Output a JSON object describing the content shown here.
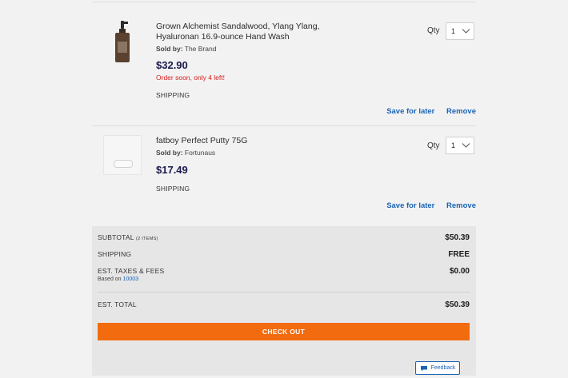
{
  "items": [
    {
      "title_line1": "Grown Alchemist Sandalwood, Ylang Ylang,",
      "title_line2": "Hyaluronan 16.9-ounce Hand Wash",
      "sold_by_label": "Sold by:",
      "seller": "The Brand",
      "price": "$32.90",
      "stock_warning": "Order soon, only 4 left!",
      "shipping": "SHIPPING",
      "qty_label": "Qty",
      "qty_value": "1",
      "save_for_later": "Save for later",
      "remove": "Remove",
      "image_icon": "hand-wash-bottle-icon"
    },
    {
      "title_line1": "fatboy Perfect Putty 75G",
      "sold_by_label": "Sold by:",
      "seller": "Fortunaus",
      "price": "$17.49",
      "shipping": "SHIPPING",
      "qty_label": "Qty",
      "qty_value": "1",
      "save_for_later": "Save for later",
      "remove": "Remove",
      "image_icon": "putty-tin-icon"
    }
  ],
  "summary": {
    "subtotal_label": "SUBTOTAL",
    "subtotal_items": "(2 ITEMS)",
    "subtotal_value": "$50.39",
    "shipping_label": "SHIPPING",
    "shipping_value": "FREE",
    "taxes_label": "EST. TAXES & FEES",
    "based_on_label": "Based on",
    "zip": "10003",
    "taxes_value": "$0.00",
    "total_label": "EST. TOTAL",
    "total_value": "$50.39",
    "checkout_label": "CHECK OUT",
    "feedback_label": "Feedback"
  },
  "colors": {
    "accent_orange": "#f26b0f",
    "link_blue": "#1a64b6",
    "price_navy": "#1a1a4e",
    "warning_red": "#d62020"
  }
}
